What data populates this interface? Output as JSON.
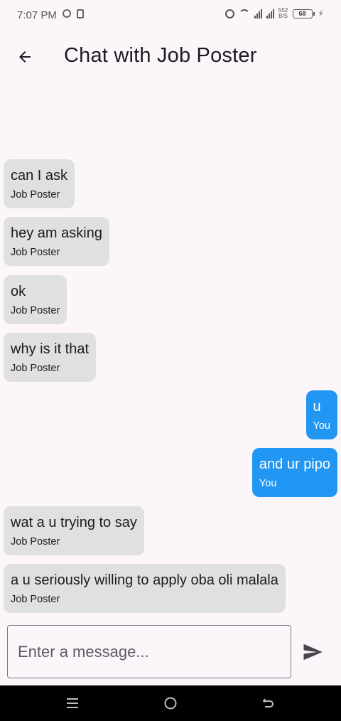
{
  "status_bar": {
    "time": "7:07 PM",
    "speed": "552\nB/S",
    "battery": "68"
  },
  "app_bar": {
    "title": "Chat with Job Poster"
  },
  "messages": [
    {
      "text": "can I ask",
      "sender": "Job Poster",
      "from_me": false
    },
    {
      "text": "hey am asking",
      "sender": "Job Poster",
      "from_me": false
    },
    {
      "text": "ok",
      "sender": "Job Poster",
      "from_me": false
    },
    {
      "text": "why is it that",
      "sender": "Job Poster",
      "from_me": false
    },
    {
      "text": "u",
      "sender": "You",
      "from_me": true
    },
    {
      "text": "and ur pipo",
      "sender": "You",
      "from_me": true
    },
    {
      "text": "wat a u trying to say",
      "sender": "Job Poster",
      "from_me": false
    },
    {
      "text": "a u seriously willing to apply oba oli malala",
      "sender": "Job Poster",
      "from_me": false
    }
  ],
  "composer": {
    "placeholder": "Enter a message..."
  },
  "colors": {
    "background": "#FCF6FB",
    "their_bubble": "#E0E0E0",
    "my_bubble": "#2196F3",
    "nav_bar": "#000000"
  },
  "icons": {
    "back": "arrow-left-icon",
    "send": "send-icon",
    "nav_menu": "menu-icon",
    "nav_home": "home-circle-icon",
    "nav_back": "back-gesture-icon"
  }
}
